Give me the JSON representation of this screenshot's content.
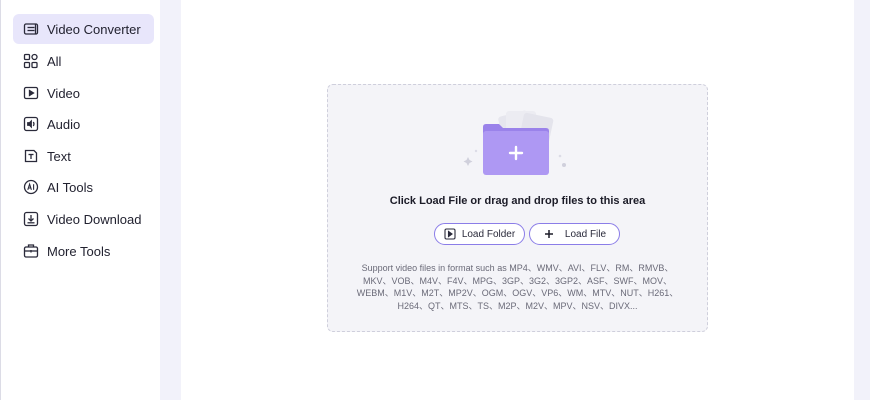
{
  "sidebar": {
    "items": [
      {
        "label": "Video Converter",
        "icon": "video-converter-icon",
        "active": true
      },
      {
        "label": "All",
        "icon": "grid-icon",
        "active": false
      },
      {
        "label": "Video",
        "icon": "video-icon",
        "active": false
      },
      {
        "label": "Audio",
        "icon": "audio-icon",
        "active": false
      },
      {
        "label": "Text",
        "icon": "text-icon",
        "active": false
      },
      {
        "label": "AI Tools",
        "icon": "ai-icon",
        "active": false
      },
      {
        "label": "Video Download",
        "icon": "download-icon",
        "active": false
      },
      {
        "label": "More Tools",
        "icon": "toolbox-icon",
        "active": false
      }
    ]
  },
  "dropzone": {
    "title": "Click Load File or drag and drop files to this area",
    "load_folder_label": "Load Folder",
    "load_file_label": "Load File",
    "support_lines": [
      "Support video files in format such as MP4、WMV、AVI、FLV、RM、RMVB、",
      "MKV、VOB、M4V、F4V、MPG、3GP、3G2、3GP2、ASF、SWF、MOV、",
      "WEBM、M1V、M2T、MP2V、OGM、OGV、VP6、WM、MTV、NUT、H261、",
      "H264、QT、MTS、TS、M2P、M2V、MPV、NSV、DIVX..."
    ]
  },
  "colors": {
    "accent": "#8b7de8",
    "folder": "#a992f0",
    "active_bg": "#e8e6fb",
    "background": "#f2f2fa"
  }
}
